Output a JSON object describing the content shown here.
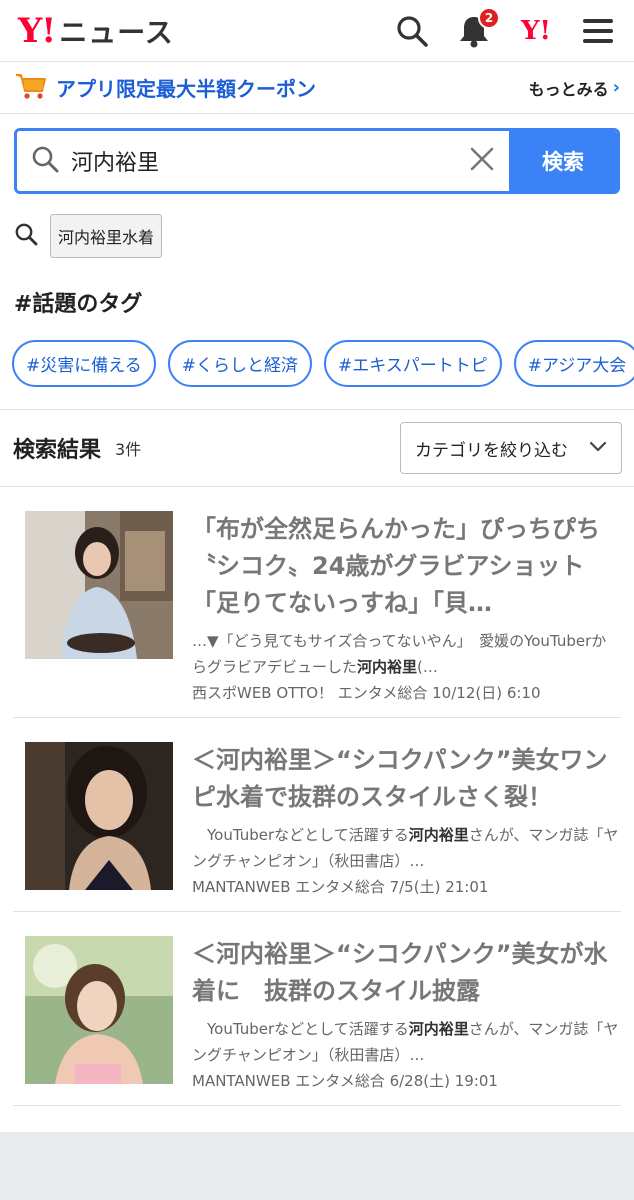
{
  "header": {
    "logo_mark": "Y!",
    "logo_text": "ニュース",
    "notification_count": "2",
    "yahoo_small": "Y!"
  },
  "promo": {
    "text": "アプリ限定最大半額クーポン",
    "more": "もっとみる"
  },
  "search": {
    "query": "河内裕里",
    "button": "検索"
  },
  "suggestion": {
    "chip": "河内裕里水着"
  },
  "tags": {
    "title": "#話題のタグ",
    "items": [
      "#災害に備える",
      "#くらしと経済",
      "#エキスパートトピ",
      "#アジア大会"
    ]
  },
  "results": {
    "title": "検索結果",
    "count": "3件",
    "category_label": "カテゴリを絞り込む"
  },
  "articles": [
    {
      "title": "「布が全然足らんかった」ぴっちぴち〝シコク〟24歳がグラビアショット「足りてないっすね」「貝…",
      "snippet_pre": "…▼「どう見てもサイズ合ってないやん」　愛媛のYouTuberからグラビアデビューした",
      "snippet_hl": "河内裕里",
      "snippet_post": "(…",
      "meta": "西スポWEB OTTO！ エンタメ総合 10/12(日) 6:10"
    },
    {
      "title": "＜河内裕里＞“シコクパンク”美女ワンピ水着で抜群のスタイルさく裂！",
      "snippet_pre": "　YouTuberなどとして活躍する",
      "snippet_hl": "河内裕里",
      "snippet_post": "さんが、マンガ誌「ヤングチャンピオン」（秋田書店）…",
      "meta": "MANTANWEB エンタメ総合 7/5(土) 21:01"
    },
    {
      "title": "＜河内裕里＞“シコクパンク”美女が水着に　抜群のスタイル披露",
      "snippet_pre": "　YouTuberなどとして活躍する",
      "snippet_hl": "河内裕里",
      "snippet_post": "さんが、マンガ誌「ヤングチャンピオン」（秋田書店）…",
      "meta": "MANTANWEB エンタメ総合 6/28(土) 19:01"
    }
  ],
  "colors": {
    "brand_red": "#ff0033",
    "accent_blue": "#3b82f6",
    "link_blue": "#1a5fd6"
  }
}
